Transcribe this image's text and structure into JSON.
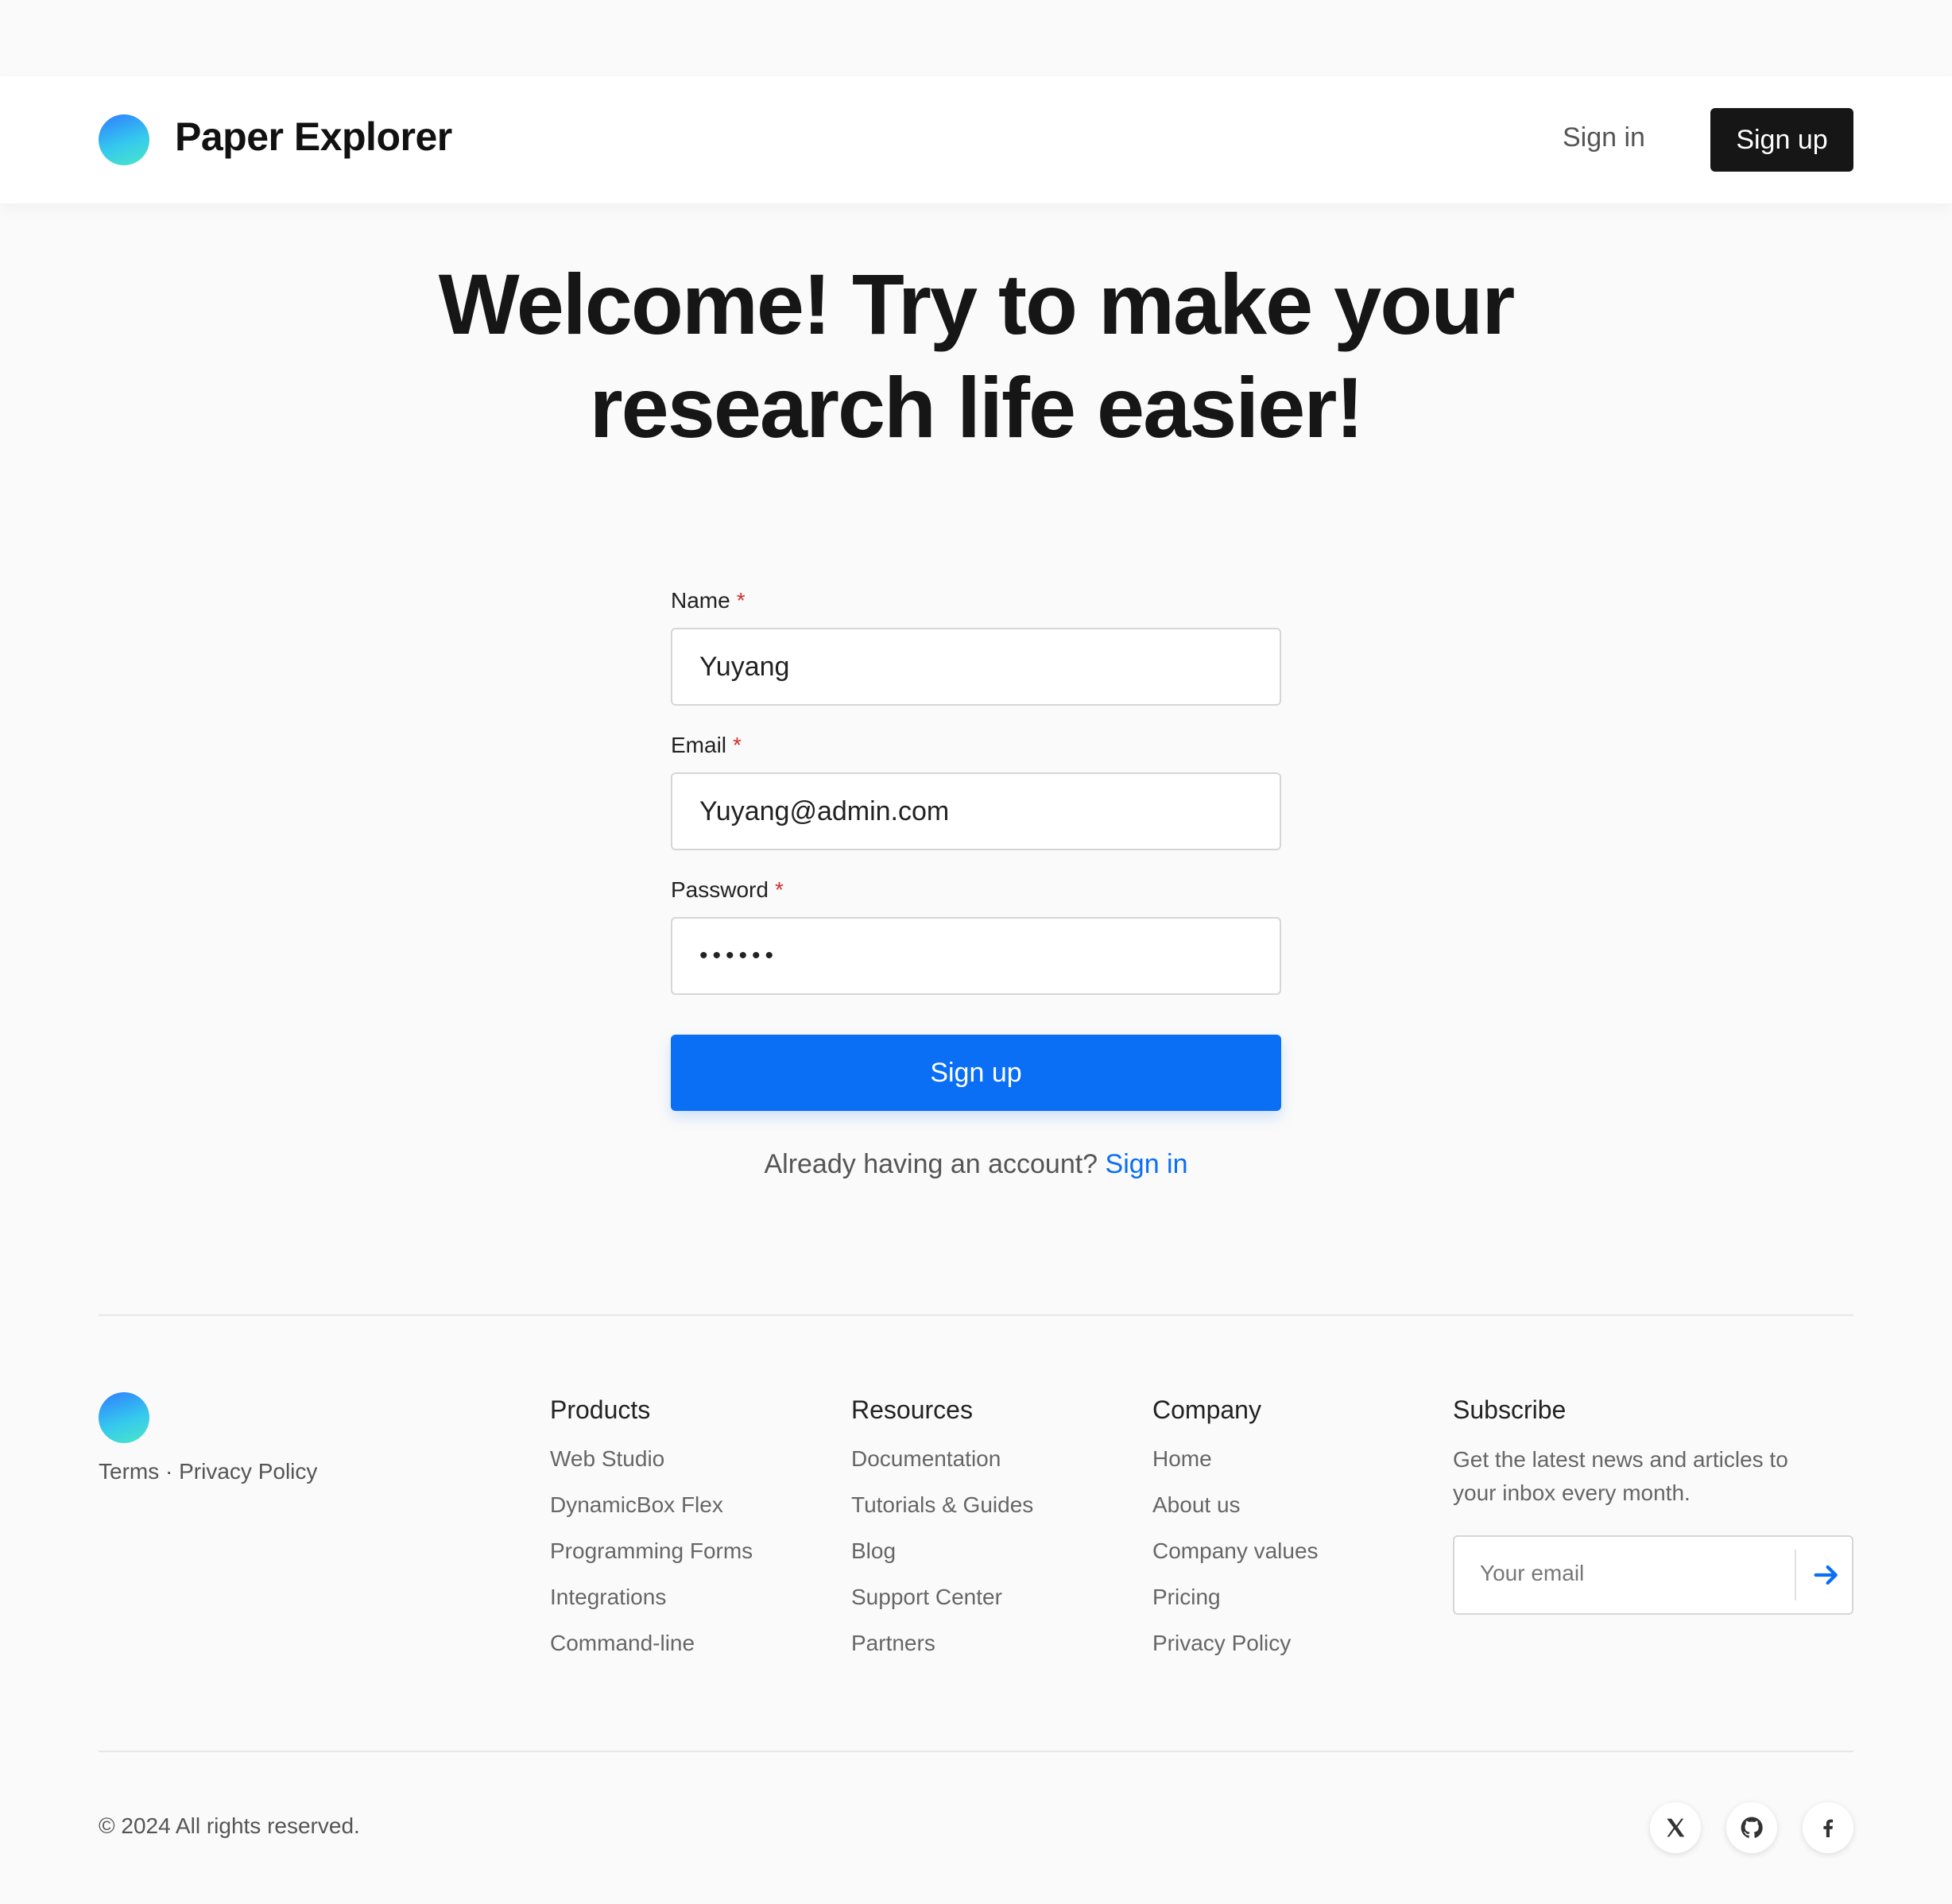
{
  "header": {
    "brand_name": "Paper Explorer",
    "signin_label": "Sign in",
    "signup_label": "Sign up"
  },
  "hero": {
    "title_line1": "Welcome! Try to make your",
    "title_line2": "research life easier!"
  },
  "form": {
    "name_label": "Name",
    "name_value": "Yuyang",
    "email_label": "Email",
    "email_value": "Yuyang@admin.com",
    "password_label": "Password",
    "password_value": "••••••",
    "required_marker": "*",
    "submit_label": "Sign up",
    "account_prompt": "Already having an account?",
    "account_link": "Sign in"
  },
  "footer": {
    "legal_terms": "Terms",
    "legal_sep": " · ",
    "legal_privacy": "Privacy Policy",
    "columns": [
      {
        "title": "Products",
        "items": [
          "Web Studio",
          "DynamicBox Flex",
          "Programming Forms",
          "Integrations",
          "Command-line"
        ]
      },
      {
        "title": "Resources",
        "items": [
          "Documentation",
          "Tutorials & Guides",
          "Blog",
          "Support Center",
          "Partners"
        ]
      },
      {
        "title": "Company",
        "items": [
          "Home",
          "About us",
          "Company values",
          "Pricing",
          "Privacy Policy"
        ]
      }
    ],
    "subscribe": {
      "title": "Subscribe",
      "text": "Get the latest news and articles to your inbox every month.",
      "placeholder": "Your email",
      "submit_icon": "arrow-right-icon"
    },
    "copyright": "© 2024 All rights reserved.",
    "social": [
      "x-icon",
      "github-icon",
      "facebook-icon"
    ]
  },
  "colors": {
    "primary": "#0a6ff5",
    "dark_button": "#161616",
    "required": "#d32f2f",
    "background": "#fafafa"
  }
}
